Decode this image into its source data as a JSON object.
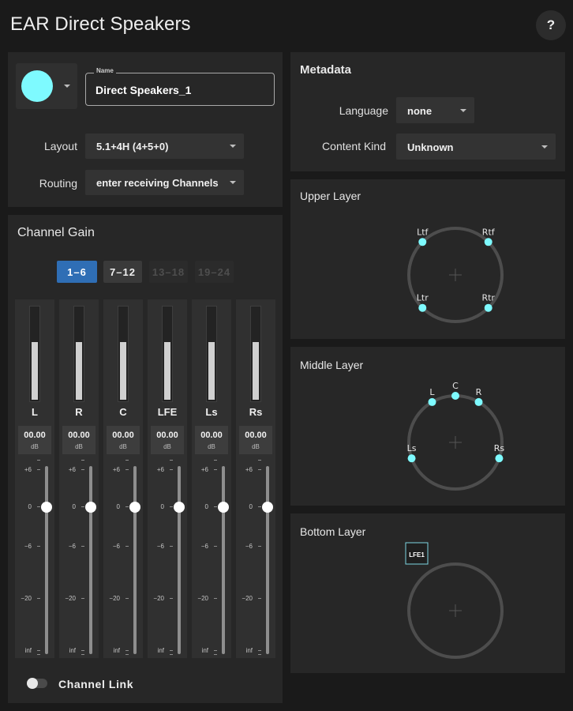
{
  "app": {
    "title": "EAR Direct Speakers",
    "help_label": "?"
  },
  "colors": {
    "accent_cyan": "#7efaff",
    "selected_bank": "#2f6eb5",
    "background": "#1a1a1a",
    "panel": "#272727"
  },
  "settings": {
    "color_swatch": "#7efaff",
    "name_label": "Name",
    "name_value": "Direct Speakers_1",
    "layout_label": "Layout",
    "layout_value": "5.1+4H (4+5+0)",
    "routing_label": "Routing",
    "routing_value": "enter receiving Channels"
  },
  "metadata": {
    "title": "Metadata",
    "language_label": "Language",
    "language_value": "none",
    "content_kind_label": "Content Kind",
    "content_kind_value": "Unknown"
  },
  "channel_gain": {
    "title": "Channel Gain",
    "banks": [
      {
        "label": "1–6",
        "state": "selected"
      },
      {
        "label": "7–12",
        "state": "enabled"
      },
      {
        "label": "13–18",
        "state": "disabled"
      },
      {
        "label": "19–24",
        "state": "disabled"
      }
    ],
    "scale_labels": [
      "+6",
      "0",
      "−6",
      "−20",
      "inf"
    ],
    "channels": [
      {
        "name": "L",
        "gain": "00.00",
        "unit": "dB",
        "meter_level": 0.62,
        "fader_db": 0
      },
      {
        "name": "R",
        "gain": "00.00",
        "unit": "dB",
        "meter_level": 0.62,
        "fader_db": 0
      },
      {
        "name": "C",
        "gain": "00.00",
        "unit": "dB",
        "meter_level": 0.62,
        "fader_db": 0
      },
      {
        "name": "LFE",
        "gain": "00.00",
        "unit": "dB",
        "meter_level": 0.62,
        "fader_db": 0
      },
      {
        "name": "Ls",
        "gain": "00.00",
        "unit": "dB",
        "meter_level": 0.62,
        "fader_db": 0
      },
      {
        "name": "Rs",
        "gain": "00.00",
        "unit": "dB",
        "meter_level": 0.62,
        "fader_db": 0
      }
    ],
    "link_label": "Channel Link",
    "link_on": false
  },
  "layers": {
    "upper": {
      "title": "Upper Layer",
      "speakers": [
        {
          "label": "Ltf",
          "azimuth": 45
        },
        {
          "label": "Rtf",
          "azimuth": -45
        },
        {
          "label": "Ltr",
          "azimuth": 135
        },
        {
          "label": "Rtr",
          "azimuth": -135
        }
      ]
    },
    "middle": {
      "title": "Middle Layer",
      "speakers": [
        {
          "label": "L",
          "azimuth": 30
        },
        {
          "label": "C",
          "azimuth": 0
        },
        {
          "label": "R",
          "azimuth": -30
        },
        {
          "label": "Ls",
          "azimuth": 110
        },
        {
          "label": "Rs",
          "azimuth": -110
        }
      ]
    },
    "bottom": {
      "title": "Bottom Layer",
      "lfe_label": "LFE1"
    }
  }
}
